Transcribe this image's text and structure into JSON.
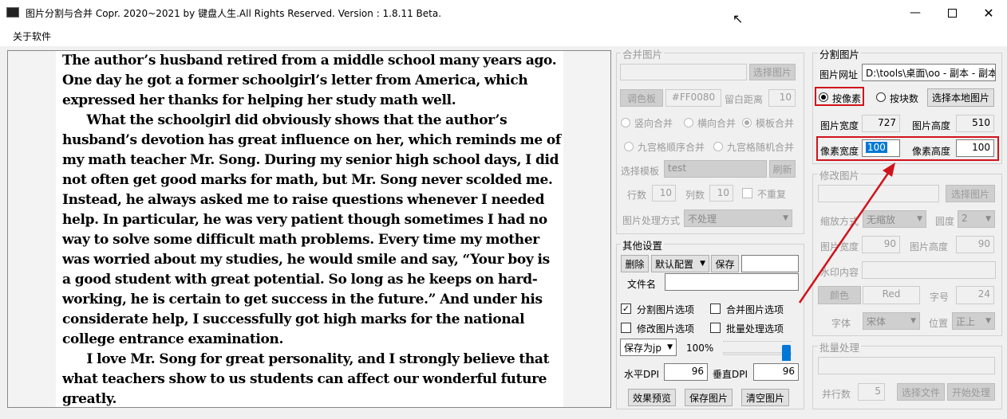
{
  "window": {
    "title": "图片分割与合并    Copr. 2020~2021 by 键盘人生.All Rights Reserved.  Version : 1.8.11 Beta."
  },
  "menu": {
    "about": "关于软件"
  },
  "document_lines_p1": [
    "The author’s husband retired from a middle school many years ago.",
    "One day he got a former schoolgirl’s letter from America, which",
    "expressed her thanks for helping her study math well."
  ],
  "document_lines_p2": [
    "    What the schoolgirl did obviously shows that the author’s",
    "husband’s devotion has great influence on her, which reminds me of",
    "my math teacher Mr. Song. During my senior high school days, I did",
    "not often get good marks for math, but Mr. Song never scolded me.",
    "Instead, he always asked me to raise questions whenever I needed",
    "help. In particular, he was very patient though sometimes I had no",
    "way to solve some difficult math problems. Every time my mother",
    "was worried about my studies, he would smile and say, “Your boy is",
    "a good student with great potential. So long as he keeps on hard-",
    "working, he is certain to get success in the future.” And under his",
    "considerate help, I successfully got high marks for the national",
    "college entrance examination."
  ],
  "document_lines_p3": [
    "    I love Mr. Song for great personality, and I strongly believe that",
    "what teachers show to us students can affect our wonderful future",
    "greatly."
  ],
  "merge": {
    "title": "合并图片",
    "select_btn": "选择图片",
    "palette_btn": "调色板",
    "color_value": "#FF0080",
    "margin_label": "留白距离",
    "margin_value": "10",
    "vertical": "竖向合并",
    "horizontal": "横向合并",
    "template": "模板合并",
    "grid_seq": "九宫格顺序合并",
    "grid_rand": "九宫格随机合并",
    "template_label": "选择模板",
    "template_value": "test",
    "refresh": "刷新",
    "rows_label": "行数",
    "rows_value": "10",
    "cols_label": "列数",
    "cols_value": "10",
    "no_repeat": "不重复",
    "process_label": "图片处理方式",
    "process_value": "不处理"
  },
  "other": {
    "title": "其他设置",
    "delete_btn": "删除",
    "preset": "默认配置",
    "save_btn": "保存",
    "filename_label": "文件名",
    "opt_split": "分割图片选项",
    "opt_merge": "合并图片选项",
    "opt_modify": "修改图片选项",
    "opt_batch": "批量处理选项",
    "save_as": "保存为jp",
    "quality": "100%",
    "hdpi_label": "水平DPI",
    "hdpi_value": "96",
    "vdpi_label": "垂直DPI",
    "vdpi_value": "96",
    "preview_btn": "效果预览",
    "save_img_btn": "保存图片",
    "clear_btn": "清空图片"
  },
  "split": {
    "title": "分割图片",
    "url_label": "图片网址",
    "url_value": "D:\\tools\\桌面\\oo - 副本 - 副本",
    "by_pixel": "按像素",
    "by_block": "按块数",
    "select_local": "选择本地图片",
    "img_width_label": "图片宽度",
    "img_width": "727",
    "img_height_label": "图片高度",
    "img_height": "510",
    "px_width_label": "像素宽度",
    "px_width": "100",
    "px_height_label": "像素高度",
    "px_height": "100"
  },
  "modify": {
    "title": "修改图片",
    "select_btn": "选择图片",
    "scale_label": "缩放方式",
    "scale_value": "无缩放",
    "round_label": "圆度",
    "round_value": "2",
    "w_label": "图片宽度",
    "w_value": "90",
    "h_label": "图片高度",
    "h_value": "90",
    "wm_label": "水印内容",
    "color_btn": "颜色",
    "color_value": "Red",
    "size_label": "字号",
    "size_value": "24",
    "font_label": "字体",
    "font_value": "宋体",
    "pos_label": "位置",
    "pos_value": "正上"
  },
  "batch": {
    "title": "批量处理",
    "rows_label": "并行数",
    "rows_value": "5",
    "select_btn": "选择文件",
    "start_btn": "开始处理"
  },
  "colors": {
    "highlight": "#d0141c",
    "selection": "#0078d7"
  }
}
